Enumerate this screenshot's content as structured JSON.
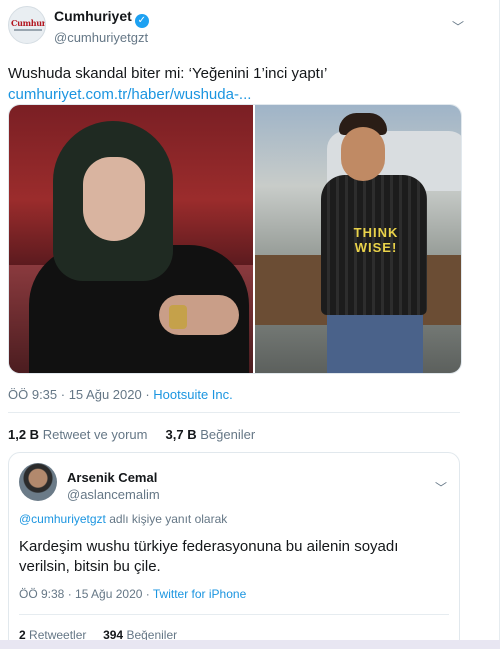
{
  "tweet": {
    "author_name": "Cumhuriyet",
    "author_handle": "@cumhuriyetgzt",
    "avatar_logo": "Cumhuriyet",
    "text": "Wushuda skandal biter mi: ‘Yeğenini 1’inci yaptı’",
    "link": "cumhuriyet.com.tr/haber/wushuda-...",
    "time": "ÖÖ 9:35 · 15 Ağu 2020 · ",
    "source": "Hootsuite Inc.",
    "retweets_count": "1,2 B",
    "retweets_label": "Retweet ve yorum",
    "likes_count": "3,7 B",
    "likes_label": "Beğeniler",
    "photo_shirt_text": "THINK\nWISE!"
  },
  "reply": {
    "author_name": "Arsenik Cemal",
    "author_handle": "@aslancemalim",
    "replying_mention": "@cumhuriyetgzt",
    "replying_suffix": " adlı kişiye yanıt olarak",
    "text": "Kardeşim wushu türkiye federasyonuna bu ailenin soyadı verilsin, bitsin bu çile.",
    "time": "ÖÖ 9:38 · 15 Ağu 2020 · ",
    "source": "Twitter for iPhone",
    "retweets_count": "2",
    "retweets_label": "Retweetler",
    "likes_count": "394",
    "likes_label": "Beğeniler"
  },
  "icons": {
    "verified": "verified-badge-icon",
    "chevron": "chevron-down-icon"
  },
  "colors": {
    "link": "#1b95e0",
    "verified": "#1da1f2",
    "text": "#14171a",
    "muted": "#657786"
  }
}
